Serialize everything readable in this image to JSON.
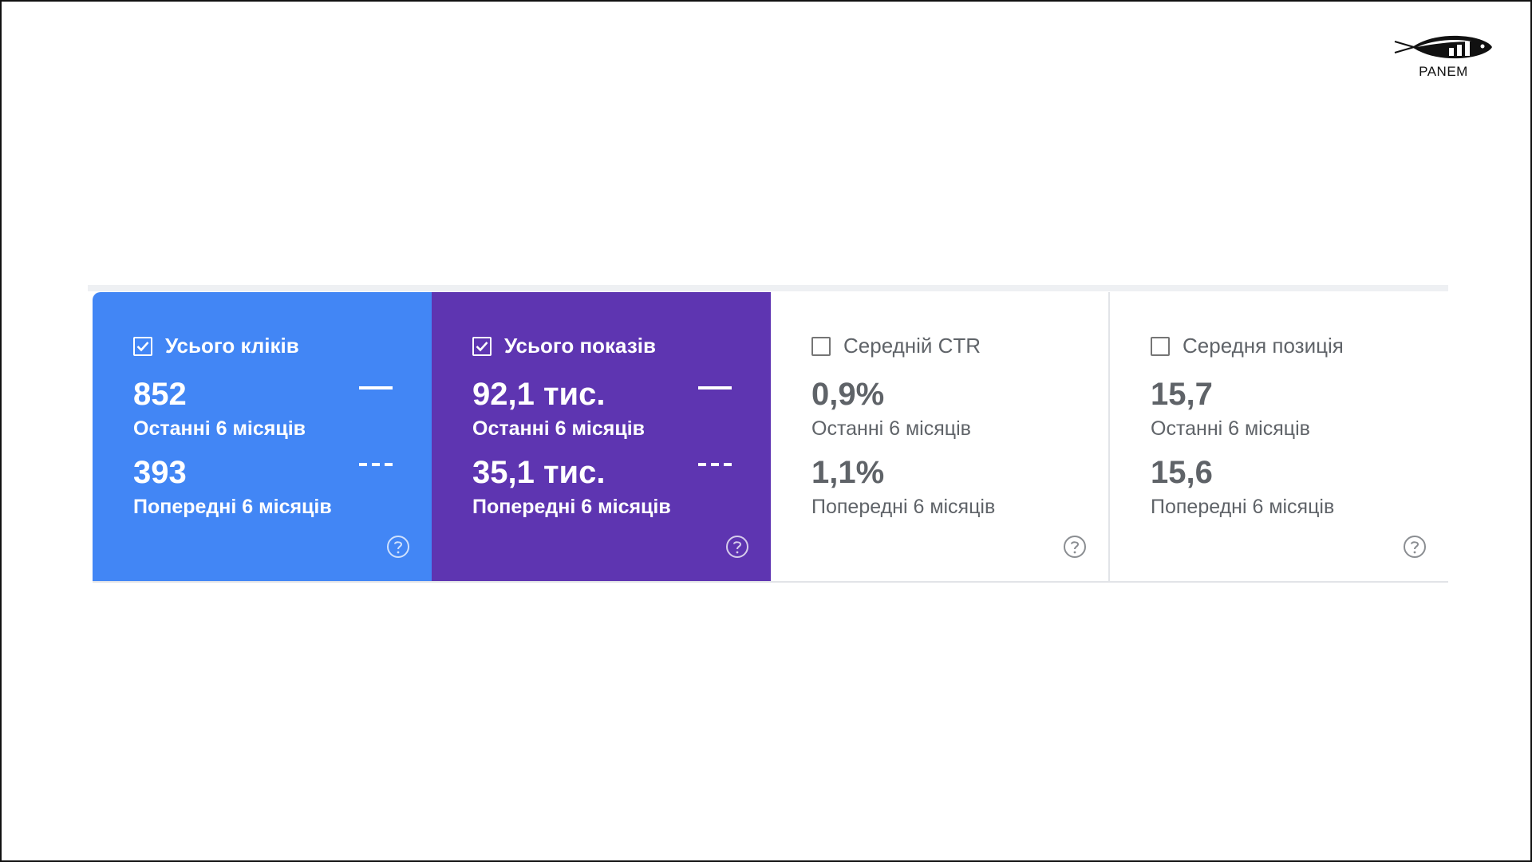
{
  "logo": {
    "text": "PANEM"
  },
  "colors": {
    "clicks": "#4286f5",
    "impressions": "#5e35b1",
    "inactive_text": "#5f6368"
  },
  "cards": [
    {
      "label": "Усього кліків",
      "checked": true,
      "current": "852",
      "current_period": "Останні 6 місяців",
      "previous": "393",
      "previous_period": "Попередні 6 місяців"
    },
    {
      "label": "Усього показів",
      "checked": true,
      "current": "92,1 тис.",
      "current_period": "Останні 6 місяців",
      "previous": "35,1 тис.",
      "previous_period": "Попередні 6 місяців"
    },
    {
      "label": "Середній CTR",
      "checked": false,
      "current": "0,9%",
      "current_period": "Останні 6 місяців",
      "previous": "1,1%",
      "previous_period": "Попередні 6 місяців"
    },
    {
      "label": "Середня позиція",
      "checked": false,
      "current": "15,7",
      "current_period": "Останні 6 місяців",
      "previous": "15,6",
      "previous_period": "Попередні 6 місяців"
    }
  ],
  "icons": {
    "checkbox_checked": "check-icon",
    "help": "help-circle-icon",
    "logo": "fish-chart-icon"
  }
}
